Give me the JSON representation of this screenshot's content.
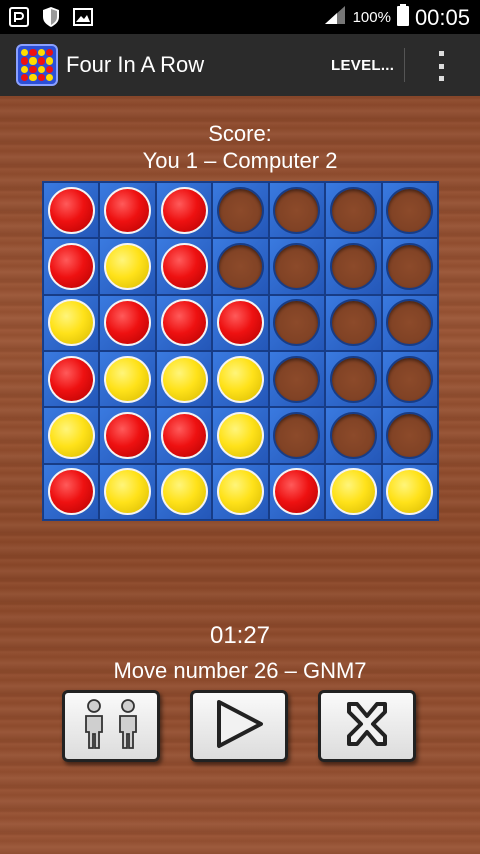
{
  "status_bar": {
    "battery_percent": "100%",
    "time": "00:05"
  },
  "action_bar": {
    "title": "Four In A Row",
    "level_button": "LEVEL...",
    "app_icon": "four-in-a-row-logo",
    "overflow_icon": "overflow-menu-icon"
  },
  "score": {
    "label": "Score:",
    "line": "You 1 – Computer 2"
  },
  "board": {
    "columns": 7,
    "rows": 6,
    "cells": [
      [
        "red",
        "red",
        "red",
        "empty",
        "empty",
        "empty",
        "empty"
      ],
      [
        "red",
        "yellow",
        "red",
        "empty",
        "empty",
        "empty",
        "empty"
      ],
      [
        "yellow",
        "red",
        "red",
        "red",
        "empty",
        "empty",
        "empty"
      ],
      [
        "red",
        "yellow",
        "yellow",
        "yellow",
        "empty",
        "empty",
        "empty"
      ],
      [
        "yellow",
        "red",
        "red",
        "yellow",
        "empty",
        "empty",
        "empty"
      ],
      [
        "red",
        "yellow",
        "yellow",
        "yellow",
        "red",
        "yellow",
        "yellow"
      ]
    ]
  },
  "timer": "01:27",
  "move_text": "Move number 26 – GNM7",
  "controls": {
    "players_icon": "two-players-icon",
    "play_icon": "play-icon",
    "stop_icon": "close-icon"
  },
  "colors": {
    "board": "#2a62c8",
    "red_disc": "#ee1111",
    "yellow_disc": "#ffe21a",
    "wood": "#8e4a2c"
  }
}
